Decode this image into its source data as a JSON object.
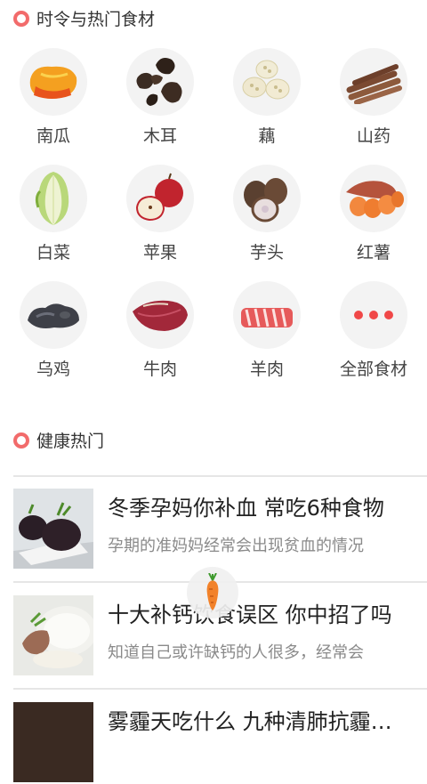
{
  "seasonal": {
    "title": "时令与热门食材",
    "items": [
      {
        "label": "南瓜",
        "icon": "pumpkin-icon"
      },
      {
        "label": "木耳",
        "icon": "wood-ear-icon"
      },
      {
        "label": "藕",
        "icon": "lotus-root-icon"
      },
      {
        "label": "山药",
        "icon": "yam-icon"
      },
      {
        "label": "白菜",
        "icon": "cabbage-icon"
      },
      {
        "label": "苹果",
        "icon": "apple-icon"
      },
      {
        "label": "芋头",
        "icon": "taro-icon"
      },
      {
        "label": "红薯",
        "icon": "sweet-potato-icon"
      },
      {
        "label": "乌鸡",
        "icon": "black-chicken-icon"
      },
      {
        "label": "牛肉",
        "icon": "beef-icon"
      },
      {
        "label": "羊肉",
        "icon": "mutton-icon"
      },
      {
        "label": "全部食材",
        "icon": "more-dots-icon"
      }
    ]
  },
  "health": {
    "title": "健康热门",
    "articles": [
      {
        "title": "冬季孕妈你补血 常吃6种食物",
        "summary": "孕期的准妈妈经常会出现贫血的情况",
        "thumb": "black-rice-cake-photo"
      },
      {
        "title": "十大补钙饮食误区 你中招了吗",
        "summary": "知道自己或许缺钙的人很多，经常会",
        "thumb": "rib-soup-photo"
      },
      {
        "title": "雾霾天吃什么 九种清肺抗霾食物",
        "summary": "",
        "thumb": "dish-photo"
      }
    ]
  },
  "float_button": {
    "icon": "carrot-icon"
  },
  "colors": {
    "accent": "#f26b6b"
  }
}
